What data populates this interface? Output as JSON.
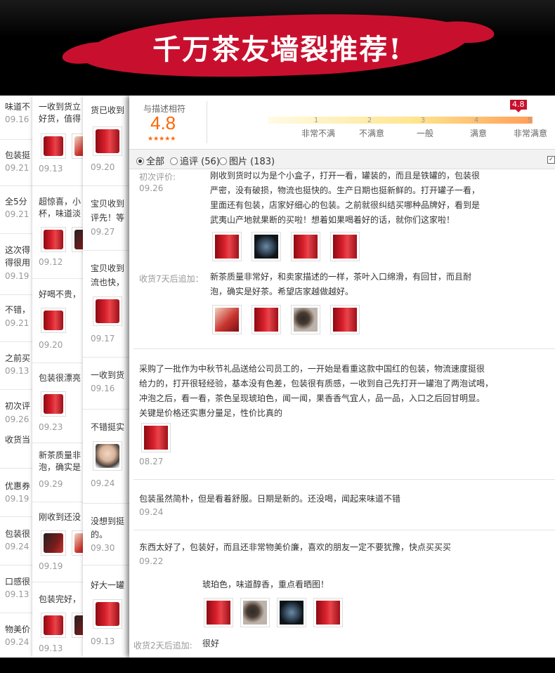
{
  "banner": {
    "title": "千万茶友墙裂推荐!"
  },
  "col1": [
    {
      "text": "味道不",
      "date": "09.16"
    },
    {
      "text": "包装挺",
      "date": "09.21"
    },
    {
      "text": "全5分",
      "date": "09.21"
    },
    {
      "text": "这次得",
      "text2": "得很用",
      "date": "09.19"
    },
    {
      "text": "不错，",
      "date": "09.21"
    },
    {
      "text": "之前买",
      "date": "09.13"
    },
    {
      "text": "初次评",
      "date": "09.26",
      "text2": "收货当"
    },
    {
      "text": "优惠券",
      "date": "09.19"
    },
    {
      "text": "包装很",
      "date": "09.24"
    },
    {
      "text": "口感很",
      "date": "09.13"
    },
    {
      "text": "物美价",
      "date": "09.24"
    }
  ],
  "col2": [
    {
      "text": "一收到货立",
      "text2": "好货，值得",
      "date": "09.13"
    },
    {
      "text": "超惊喜，小",
      "text2": "杯，味道淡",
      "date": "09.12"
    },
    {
      "text": "好喝不贵，",
      "date": "09.20"
    },
    {
      "text": "包装很漂亮",
      "date": "09.23"
    },
    {
      "text": "新茶质量非",
      "text2": "泡，确实是",
      "date": "09.29"
    },
    {
      "text": "刚收到还没",
      "date": "09.19"
    },
    {
      "text": "包装完好，",
      "date": "09.13"
    }
  ],
  "col3": [
    {
      "text": "货已收到",
      "date": "09.20"
    },
    {
      "text": "宝贝收到",
      "text2": "评先！等",
      "date": "09.27"
    },
    {
      "text": "宝贝收到",
      "text2": "流也快，",
      "date": "09.17"
    },
    {
      "text": "一收到货",
      "date": "09.16"
    },
    {
      "text": "不错挺实",
      "date": "09.24"
    },
    {
      "text": "没想到挺",
      "text2": "的。",
      "date": "09.30"
    },
    {
      "text": "好大一罐",
      "date": "09.13"
    }
  ],
  "summary": {
    "label": "与描述相符",
    "score": "4.8",
    "stars": "★★★★★",
    "badge": "4.8",
    "ticks": [
      "1",
      "2",
      "3",
      "4",
      "5"
    ],
    "levels": [
      "非常不满",
      "不满意",
      "一般",
      "满意",
      "非常满意"
    ],
    "rating_fraction": 0.96
  },
  "filter": {
    "all": "全部",
    "followup": "追评 (56)",
    "pictures": "图片 (183)"
  },
  "reviews": {
    "r1": {
      "label": "初次评价:",
      "date": "09.26",
      "lines": [
        "刚收到货时以为是个小盒子，打开一看，罐装的，而且是铁罐的，包装很",
        "严密，没有破损，物流也挺快的。生产日期也挺新鲜的。打开罐子一看，",
        "里面还有包装，店家好细心的包装。之前就很纠结买哪种品牌好，看到是",
        "武夷山产地就果断的买啦！想着如果喝着好的话，就你们这家啦！"
      ],
      "followup_label": "收货7天后追加：",
      "followup_lines": [
        "新茶质量非常好，和卖家描述的一样，茶叶入口绵滑，有回甘，而且耐",
        "泡，确实是好茶。希望店家越做越好。"
      ]
    },
    "r2": {
      "lines": [
        "采购了一批作为中秋节礼品送给公司员工的，一开始是看重这款中国红的包装，物流速度挺很",
        "给力的，打开很轻经验，基本没有色差，包装很有质感，一收到自己先打开一罐泡了两泡试喝，",
        "冲泡之后，看一看，茶色呈现琥珀色，闻一闻，果香香气宜人，品一品，入口之后回甘明显。",
        "关键是价格还实惠分量足，性价比真的"
      ],
      "date": "08.27"
    },
    "r3": {
      "text": "包装虽然简朴，但是看着舒服。日期是新的。还没喝，闻起来味道不错",
      "date": "09.24"
    },
    "r4": {
      "text": "东西太好了，包装好，而且还非常物美价廉，喜欢的朋友一定不要犹豫，快点买买买",
      "date": "09.22",
      "followup_text": "琥珀色，味道醇香，重点看晒图！",
      "followup_label": "收货2天后追加:",
      "followup_text2": "很好"
    }
  }
}
